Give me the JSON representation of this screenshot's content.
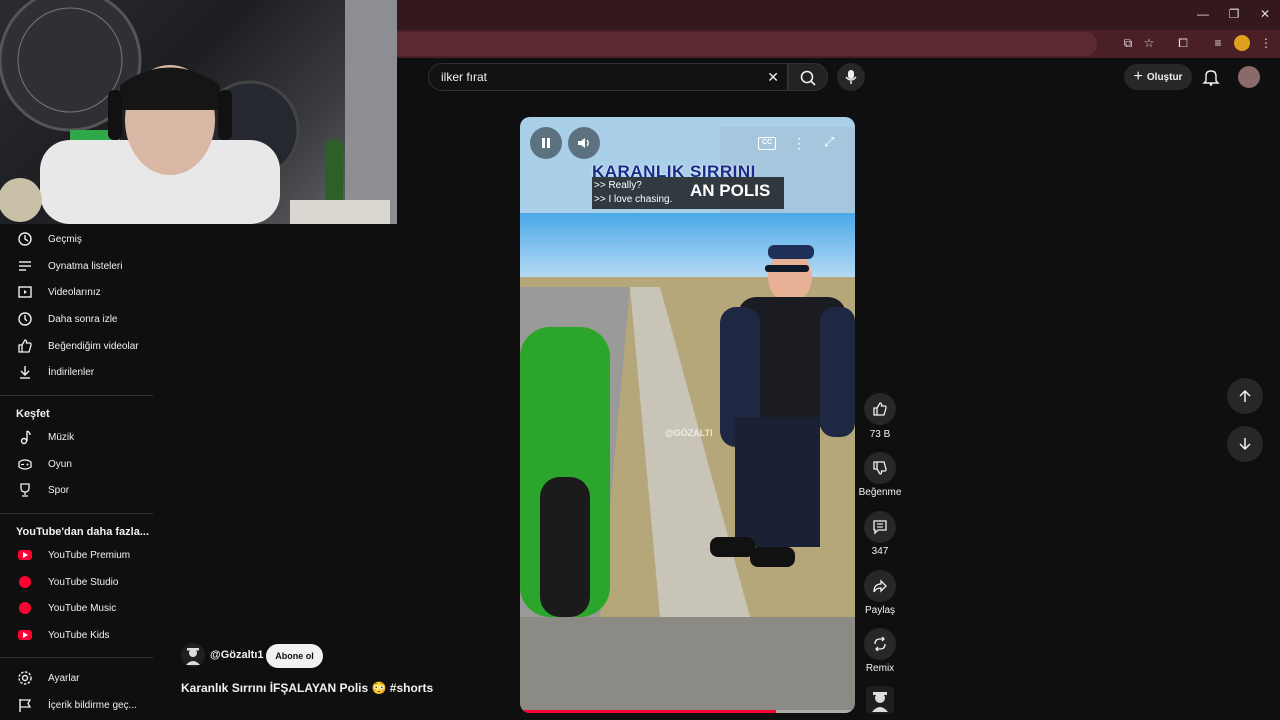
{
  "browser": {
    "window_controls": [
      "minimize",
      "restore",
      "close"
    ]
  },
  "search": {
    "query": "ilker fırat",
    "clear_icon": "close-icon",
    "search_icon": "search-icon",
    "mic_icon": "mic-icon"
  },
  "header": {
    "create_label": "Oluştur",
    "notifications_icon": "bell-icon"
  },
  "sidebar": {
    "you_items": [
      {
        "label": "Geçmiş",
        "icon": "history-icon"
      },
      {
        "label": "Oynatma listeleri",
        "icon": "playlist-icon"
      },
      {
        "label": "Videolarınız",
        "icon": "video-icon"
      },
      {
        "label": "Daha sonra izle",
        "icon": "clock-icon"
      },
      {
        "label": "Beğendiğim videolar",
        "icon": "thumbs-up-icon"
      },
      {
        "label": "İndirilenler",
        "icon": "download-icon"
      }
    ],
    "explore_title": "Keşfet",
    "explore_items": [
      {
        "label": "Müzik",
        "icon": "music-icon"
      },
      {
        "label": "Oyun",
        "icon": "gamepad-icon"
      },
      {
        "label": "Spor",
        "icon": "trophy-icon"
      }
    ],
    "more_title": "YouTube'dan daha fazla...",
    "more_items": [
      {
        "label": "YouTube Premium"
      },
      {
        "label": "YouTube Studio"
      },
      {
        "label": "YouTube Music"
      },
      {
        "label": "YouTube Kids"
      }
    ],
    "settings_items": [
      {
        "label": "Ayarlar",
        "icon": "gear-icon"
      },
      {
        "label": "İçerik bildirme geç...",
        "icon": "flag-icon"
      }
    ]
  },
  "video": {
    "overlay_title_line1": "KARANLIK SIRRINI",
    "overlay_title_line2": "AN POLIS",
    "caption_line1": ">> Really?",
    "caption_line2": ">> I love chasing.",
    "watermark": "@GÖZALTI",
    "progress": 0.77
  },
  "channel": {
    "handle": "@Gözaltı1",
    "subscribe_label": "Abone ol",
    "title": "Karanlık Sırrını İFŞALAYAN Polis 😳 #shorts"
  },
  "actions": {
    "like_count": "73 B",
    "dislike_label": "Beğenme",
    "comment_count": "347",
    "share_label": "Paylaş",
    "remix_label": "Remix"
  },
  "colors": {
    "accent_red": "#ff0033",
    "browser_frame": "#35181d",
    "background": "#0f0f0f"
  }
}
